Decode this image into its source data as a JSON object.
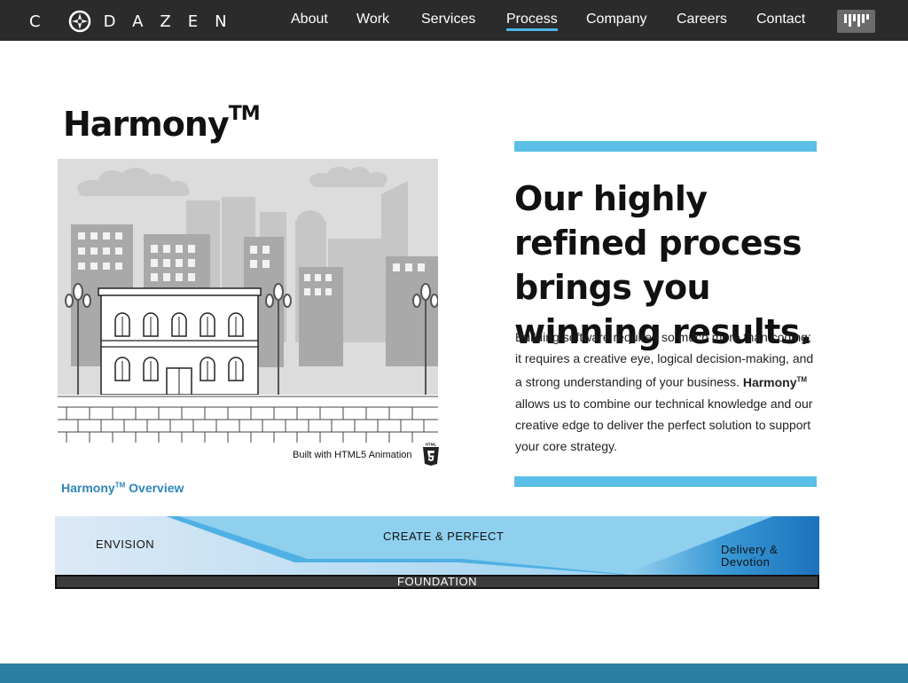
{
  "brand": {
    "name_prefix": "C",
    "name_rest": "DAZEN"
  },
  "nav": {
    "items": [
      {
        "label": "About"
      },
      {
        "label": "Work"
      },
      {
        "label": "Services"
      },
      {
        "label": "Process",
        "active": true
      },
      {
        "label": "Company"
      },
      {
        "label": "Careers"
      },
      {
        "label": "Contact"
      }
    ],
    "menu_icon": "codazen-bars-icon"
  },
  "hero": {
    "title": "Harmony",
    "title_mark": "TM",
    "animation_caption": "Built with HTML5 Animation",
    "badge_icon": "html5-icon",
    "badge_text": "HTML",
    "overview_link": {
      "text": "Harmony",
      "mark": "TM",
      "suffix": " Overview"
    }
  },
  "pitch": {
    "headline": "Our highly refined process brings you winning results.",
    "body_before": "Building software requires so much more than coding; it requires a creative eye, logical decision-making, and a strong understanding of your business. ",
    "body_strong": "Harmony",
    "body_strong_mark": "TM",
    "body_after": " allows us to combine our technical knowledge and our creative edge to deliver the perfect solution to support your core strategy."
  },
  "process_diagram": {
    "stage_1": "ENVISION",
    "stage_2": "CREATE & PERFECT",
    "stage_3_line_1": "Delivery &",
    "stage_3_line_2": "Devotion",
    "base": "FOUNDATION"
  },
  "colors": {
    "nav_bg": "#2b2b2b",
    "accent": "#5bbfe8",
    "link": "#2e86b8",
    "footer": "#2a7fa3"
  }
}
